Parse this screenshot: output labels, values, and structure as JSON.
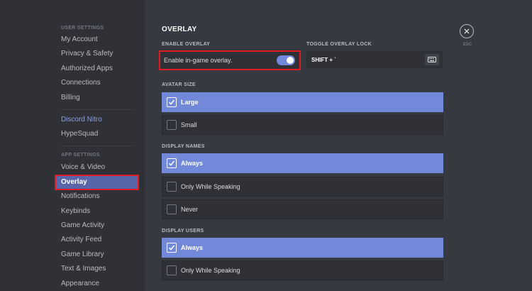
{
  "sidebar": {
    "user_settings_header": "USER SETTINGS",
    "my_account": "My Account",
    "privacy_safety": "Privacy & Safety",
    "authorized_apps": "Authorized Apps",
    "connections": "Connections",
    "billing": "Billing",
    "discord_nitro": "Discord Nitro",
    "hypesquad": "HypeSquad",
    "app_settings_header": "APP SETTINGS",
    "voice_video": "Voice & Video",
    "overlay": "Overlay",
    "notifications": "Notifications",
    "keybinds": "Keybinds",
    "game_activity": "Game Activity",
    "activity_feed": "Activity Feed",
    "game_library": "Game Library",
    "text_images": "Text & Images",
    "appearance": "Appearance"
  },
  "main": {
    "title": "OVERLAY",
    "enable_overlay_label": "ENABLE OVERLAY",
    "enable_overlay_text": "Enable in-game overlay.",
    "enable_overlay_on": true,
    "toggle_lock_label": "TOGGLE OVERLAY LOCK",
    "toggle_lock_value": "SHIFT + `",
    "avatar_size_label": "AVATAR SIZE",
    "avatar_large": "Large",
    "avatar_small": "Small",
    "display_names_label": "DISPLAY NAMES",
    "names_always": "Always",
    "names_only_speaking": "Only While Speaking",
    "names_never": "Never",
    "display_users_label": "DISPLAY USERS",
    "users_always": "Always",
    "users_only_speaking": "Only While Speaking"
  },
  "close": {
    "label": "ESC"
  },
  "colors": {
    "accent": "#7289da",
    "selected_nav": "#5865a8",
    "highlight_border": "#e01b24",
    "background": "#36393f",
    "sidebar": "#2f3136"
  }
}
